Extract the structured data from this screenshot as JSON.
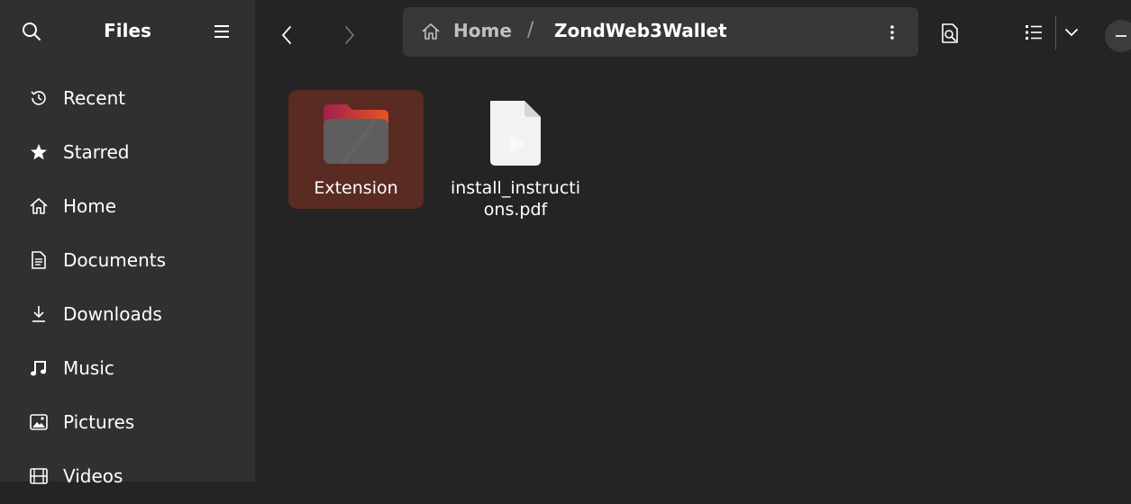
{
  "app": {
    "title": "Files"
  },
  "sidebar": {
    "items": [
      {
        "label": "Recent",
        "icon": "clock-icon"
      },
      {
        "label": "Starred",
        "icon": "star-icon"
      },
      {
        "label": "Home",
        "icon": "home-icon"
      },
      {
        "label": "Documents",
        "icon": "document-icon"
      },
      {
        "label": "Downloads",
        "icon": "download-icon"
      },
      {
        "label": "Music",
        "icon": "music-icon"
      },
      {
        "label": "Pictures",
        "icon": "picture-icon"
      },
      {
        "label": "Videos",
        "icon": "video-icon"
      }
    ]
  },
  "pathbar": {
    "home_label": "Home",
    "separator": "/",
    "current_folder": "ZondWeb3Wallet"
  },
  "files": [
    {
      "name": "Extension",
      "type": "folder",
      "selected": true
    },
    {
      "name": "install_instructions.pdf",
      "type": "pdf",
      "selected": false
    }
  ],
  "colors": {
    "sidebar_bg": "#303030",
    "content_bg": "#242424",
    "pathbar_bg": "#383838",
    "selection_bg": "#5a2b22",
    "folder_accent": "#e95420"
  }
}
